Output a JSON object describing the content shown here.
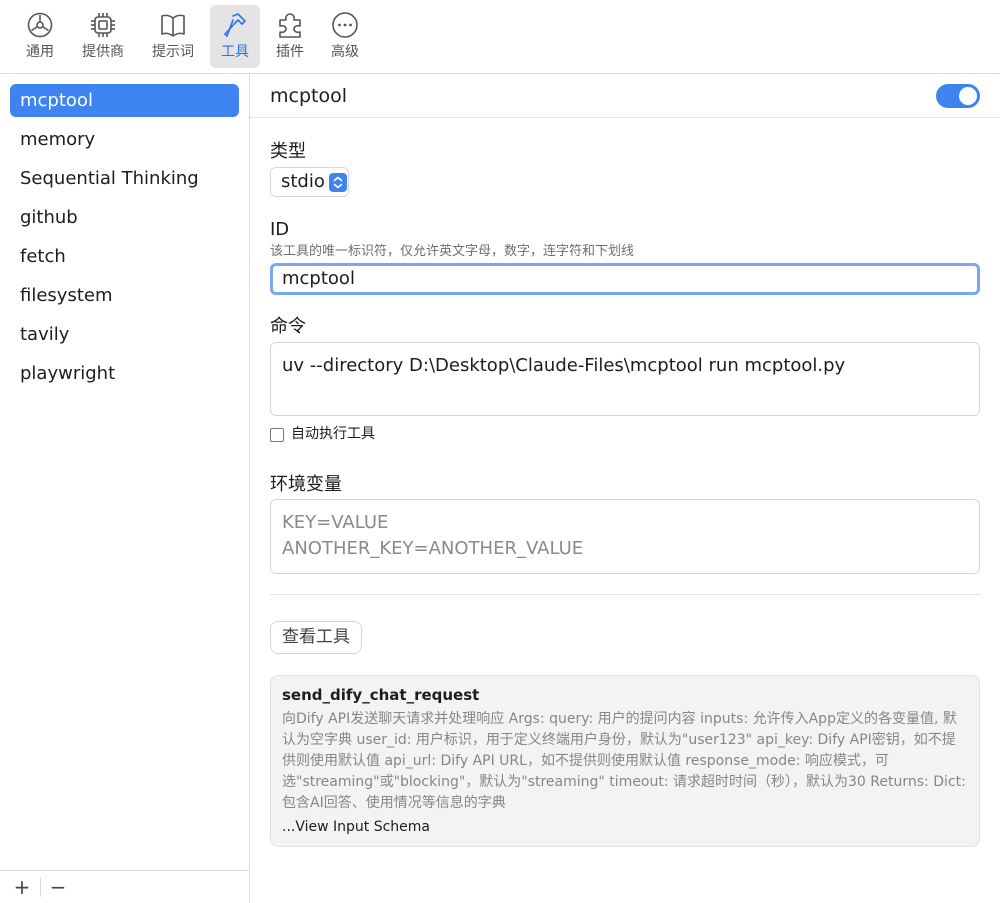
{
  "toolbar": {
    "tabs": [
      {
        "label": "通用",
        "icon": "general-icon"
      },
      {
        "label": "提供商",
        "icon": "chip-icon"
      },
      {
        "label": "提示词",
        "icon": "book-icon"
      },
      {
        "label": "工具",
        "icon": "hammer-icon",
        "active": true
      },
      {
        "label": "插件",
        "icon": "puzzle-icon"
      },
      {
        "label": "高级",
        "icon": "more-icon"
      }
    ]
  },
  "sidebar": {
    "items": [
      {
        "label": "mcptool",
        "active": true
      },
      {
        "label": "memory"
      },
      {
        "label": "Sequential Thinking"
      },
      {
        "label": "github"
      },
      {
        "label": "fetch"
      },
      {
        "label": "filesystem"
      },
      {
        "label": "tavily"
      },
      {
        "label": "playwright"
      }
    ],
    "add_label": "+",
    "remove_label": "−"
  },
  "server": {
    "name": "mcptool",
    "enabled": true
  },
  "form": {
    "type_label": "类型",
    "type_value": "stdio",
    "id_label": "ID",
    "id_hint": "该工具的唯一标识符，仅允许英文字母，数字，连字符和下划线",
    "id_value": "mcptool",
    "command_label": "命令",
    "command_value": "uv --directory D:\\Desktop\\Claude-Files\\mcptool run mcptool.py",
    "auto_exec_label": "自动执行工具",
    "auto_exec_checked": false,
    "env_label": "环境变量",
    "env_placeholder_line1": "KEY=VALUE",
    "env_placeholder_line2": "ANOTHER_KEY=ANOTHER_VALUE",
    "view_tools_label": "查看工具"
  },
  "tool_card": {
    "name": "send_dify_chat_request",
    "description": "向Dify API发送聊天请求并处理响应 Args: query: 用户的提问内容 inputs: 允许传入App定义的各变量值, 默认为空字典 user_id: 用户标识，用于定义终端用户身份，默认为\"user123\" api_key: Dify API密钥，如不提供则使用默认值 api_url: Dify API URL，如不提供则使用默认值 response_mode: 响应模式，可选\"streaming\"或\"blocking\"，默认为\"streaming\" timeout: 请求超时时间（秒），默认为30 Returns: Dict: 包含AI回答、使用情况等信息的字典",
    "schema_link": "...View Input Schema"
  },
  "colors": {
    "accent": "#3d84f0",
    "focus_ring": "#78a8ee"
  }
}
